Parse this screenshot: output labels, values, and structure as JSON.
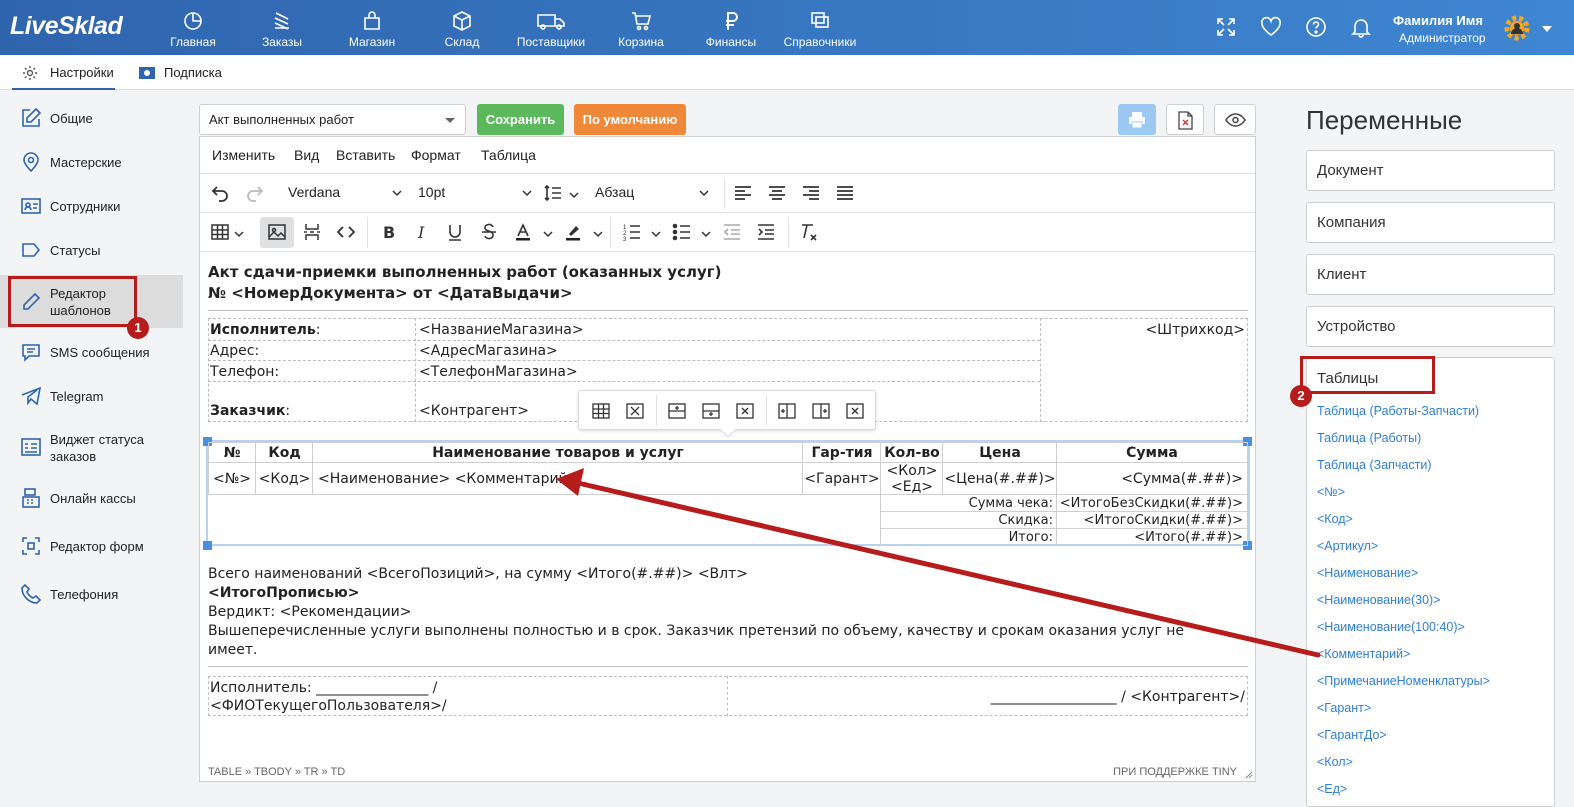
{
  "app": {
    "logo": "LiveSklad"
  },
  "nav": [
    {
      "label": "Главная",
      "icon": "dashboard-icon"
    },
    {
      "label": "Заказы",
      "icon": "orders-icon"
    },
    {
      "label": "Магазин",
      "icon": "shop-icon"
    },
    {
      "label": "Склад",
      "icon": "box-icon"
    },
    {
      "label": "Поставщики",
      "icon": "truck-icon"
    },
    {
      "label": "Корзина",
      "icon": "cart-icon"
    },
    {
      "label": "Финансы",
      "icon": "ruble-icon"
    },
    {
      "label": "Справочники",
      "icon": "directory-icon"
    }
  ],
  "user": {
    "name": "Фамилия Имя",
    "role": "Администратор"
  },
  "subtabs": [
    {
      "label": "Настройки",
      "icon": "gear-icon"
    },
    {
      "label": "Подписка",
      "icon": "banknote-icon"
    }
  ],
  "sidebar": [
    {
      "label": "Общие",
      "icon": "edit-icon"
    },
    {
      "label": "Мастерские",
      "icon": "location-icon"
    },
    {
      "label": "Сотрудники",
      "icon": "employee-card-icon"
    },
    {
      "label": "Статусы",
      "icon": "tag-icon"
    },
    {
      "label": "Редактор шаблонов",
      "icon": "pencil-icon"
    },
    {
      "label": "SMS сообщения",
      "icon": "message-icon"
    },
    {
      "label": "Telegram",
      "icon": "telegram-icon"
    },
    {
      "label": "Виджет статуса заказов",
      "icon": "widget-icon"
    },
    {
      "label": "Онлайн кассы",
      "icon": "cash-register-icon"
    },
    {
      "label": "Редактор форм",
      "icon": "form-editor-icon"
    },
    {
      "label": "Телефония",
      "icon": "phone-icon"
    }
  ],
  "badges": {
    "one": "1",
    "two": "2"
  },
  "template_select": {
    "value": "Акт выполненных работ"
  },
  "buttons": {
    "save": "Сохранить",
    "default": "По умолчанию"
  },
  "colors": {
    "primary": "#2f65ad",
    "save": "#5cb85c",
    "default": "#f0883a",
    "annotation": "#b71c1c",
    "link": "#2f7fd8"
  },
  "editor": {
    "menus": [
      "Изменить",
      "Вид",
      "Вставить",
      "Формат",
      "Таблица"
    ],
    "font": "Verdana",
    "size": "10pt",
    "block": "Абзац",
    "statusbar_path": "TABLE » TBODY » TR » TD",
    "statusbar_brand": "ПРИ ПОДДЕРЖКЕ TINY"
  },
  "doc": {
    "title1": "Акт сдачи-приемки выполненных работ (оказанных услуг)",
    "title2": "№ <НомерДокумента> от <ДатаВыдачи>",
    "executor_label": "Исполнитель",
    "executor_colon": ":",
    "executor_value": "<НазваниеМагазина>",
    "barcode": "<Штрихкод>",
    "address_label": "Адрес:",
    "address_value": "<АдресМагазина>",
    "phone_label": "Телефон:",
    "phone_value": "<ТелефонМагазина>",
    "customer_label": "Заказчик",
    "customer_colon": ":",
    "customer_value": "<Контрагент>",
    "table_headers": [
      "№",
      "Код",
      "Наименование товаров и услуг",
      "Гар-тия",
      "Кол-во",
      "Цена",
      "Сумма"
    ],
    "table_row": [
      "<№>",
      "<Код>",
      "<Наименование> <Комментарий>",
      "<Гарант>",
      "<Кол>",
      "<Ед>",
      "<Цена(#.##)>",
      "<Сумма(#.##)>"
    ],
    "totals": [
      {
        "label": "Сумма чека:",
        "value": "<ИтогоБезСкидки(#.##)>"
      },
      {
        "label": "Скидка:",
        "value": "<ИтогоСкидки(#.##)>"
      },
      {
        "label": "Итого:",
        "value": "<Итого(#.##)>"
      }
    ],
    "summary": "Всего наименований <ВсегоПозиций>, на сумму <Итого(#.##)> <Влт>",
    "total_words": "<ИтогоПрописью>",
    "verdict": "Вердикт: <Рекомендации>",
    "closing1": "Вышеперечисленные услуги выполнены полностью и в срок. Заказчик претензий по объему, качеству и срокам оказания услуг не",
    "closing2": "имеет.",
    "sign_exec1": "Исполнитель: ________________ /",
    "sign_exec2": "<ФИОТекущегоПользователя>/",
    "sign_client": "__________________ / <Контрагент>/"
  },
  "variables": {
    "title": "Переменные",
    "groups": [
      "Документ",
      "Компания",
      "Клиент",
      "Устройство"
    ],
    "open_group": "Таблицы",
    "items": [
      "Таблица (Работы-Запчасти)",
      "Таблица (Работы)",
      "Таблица (Запчасти)",
      "<№>",
      "<Код>",
      "<Артикул>",
      "<Наименование>",
      "<Наименование(30)>",
      "<Наименование(100:40)>",
      "<Комментарий>",
      "<ПримечаниеНоменклатуры>",
      "<Гарант>",
      "<ГарантДо>",
      "<Кол>",
      "<Ед>"
    ]
  }
}
